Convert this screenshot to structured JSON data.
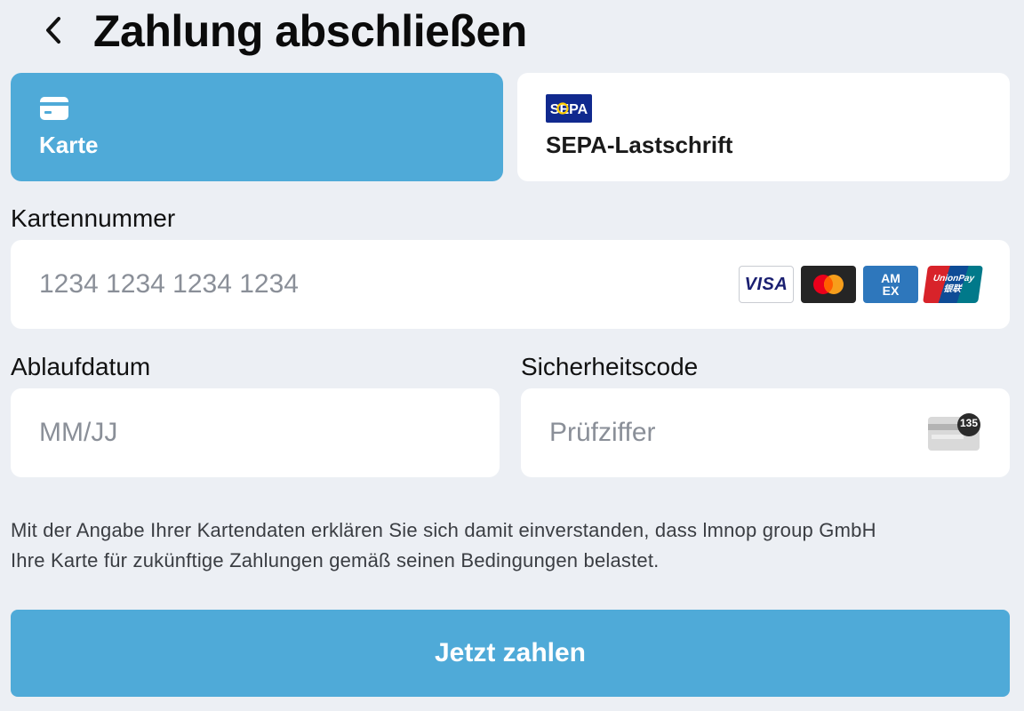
{
  "header": {
    "title": "Zahlung abschließen",
    "back_icon": "chevron-left-icon"
  },
  "tabs": [
    {
      "label": "Karte",
      "icon": "credit-card-icon",
      "selected": true,
      "bg": "#4FAAD8"
    },
    {
      "label": "SEPA-Lastschrift",
      "icon": "sepa-logo-icon",
      "logo_text": "SEPA",
      "selected": false
    }
  ],
  "card_number": {
    "label": "Kartennummer",
    "placeholder": "1234 1234 1234 1234",
    "value": ""
  },
  "card_brands": [
    {
      "name": "visa",
      "text": "VISA"
    },
    {
      "name": "mastercard",
      "text": ""
    },
    {
      "name": "amex",
      "text": "AM EX"
    },
    {
      "name": "unionpay",
      "text": "UnionPay 银联"
    }
  ],
  "expiry": {
    "label": "Ablaufdatum",
    "placeholder": "MM/JJ",
    "value": ""
  },
  "security_code": {
    "label": "Sicherheitscode",
    "placeholder": "Prüfziffer",
    "value": "",
    "icon": "cvc-card-icon",
    "icon_badge": "135"
  },
  "consent_text_line1": "Mit der Angabe Ihrer Kartendaten erklären Sie sich damit einverstanden, dass lmnop group GmbH",
  "consent_text_line2": "Ihre Karte für zukünftige Zahlungen gemäß seinen Bedingungen belastet.",
  "submit": {
    "label": "Jetzt zahlen"
  },
  "colors": {
    "accent": "#4FAAD8",
    "background": "#ECEFF4",
    "card_bg": "#FFFFFF"
  }
}
